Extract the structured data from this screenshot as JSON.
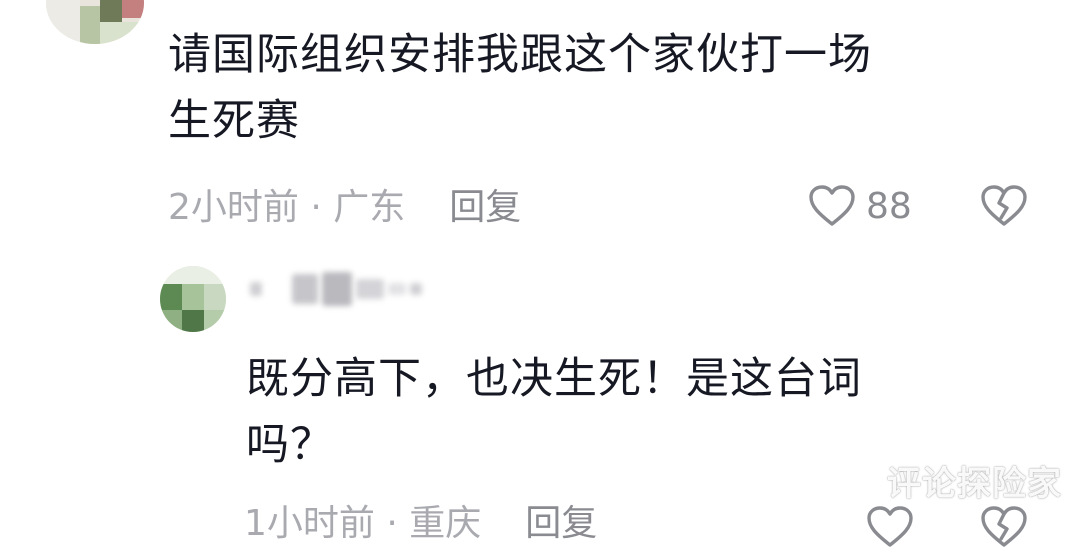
{
  "comment1": {
    "text": "请国际组织安排我跟这个家伙打一场\n生死赛",
    "time": "2小时前 · 广东",
    "reply_label": "回复",
    "likes": "88"
  },
  "comment2": {
    "text": "既分高下，也决生死！是这台词\n吗？",
    "time": "1小时前 · 重庆",
    "reply_label": "回复"
  },
  "watermark": "评论探险家",
  "colors": {
    "text": "#161823",
    "meta": "#a9aab0",
    "icon": "#8a8b91"
  }
}
